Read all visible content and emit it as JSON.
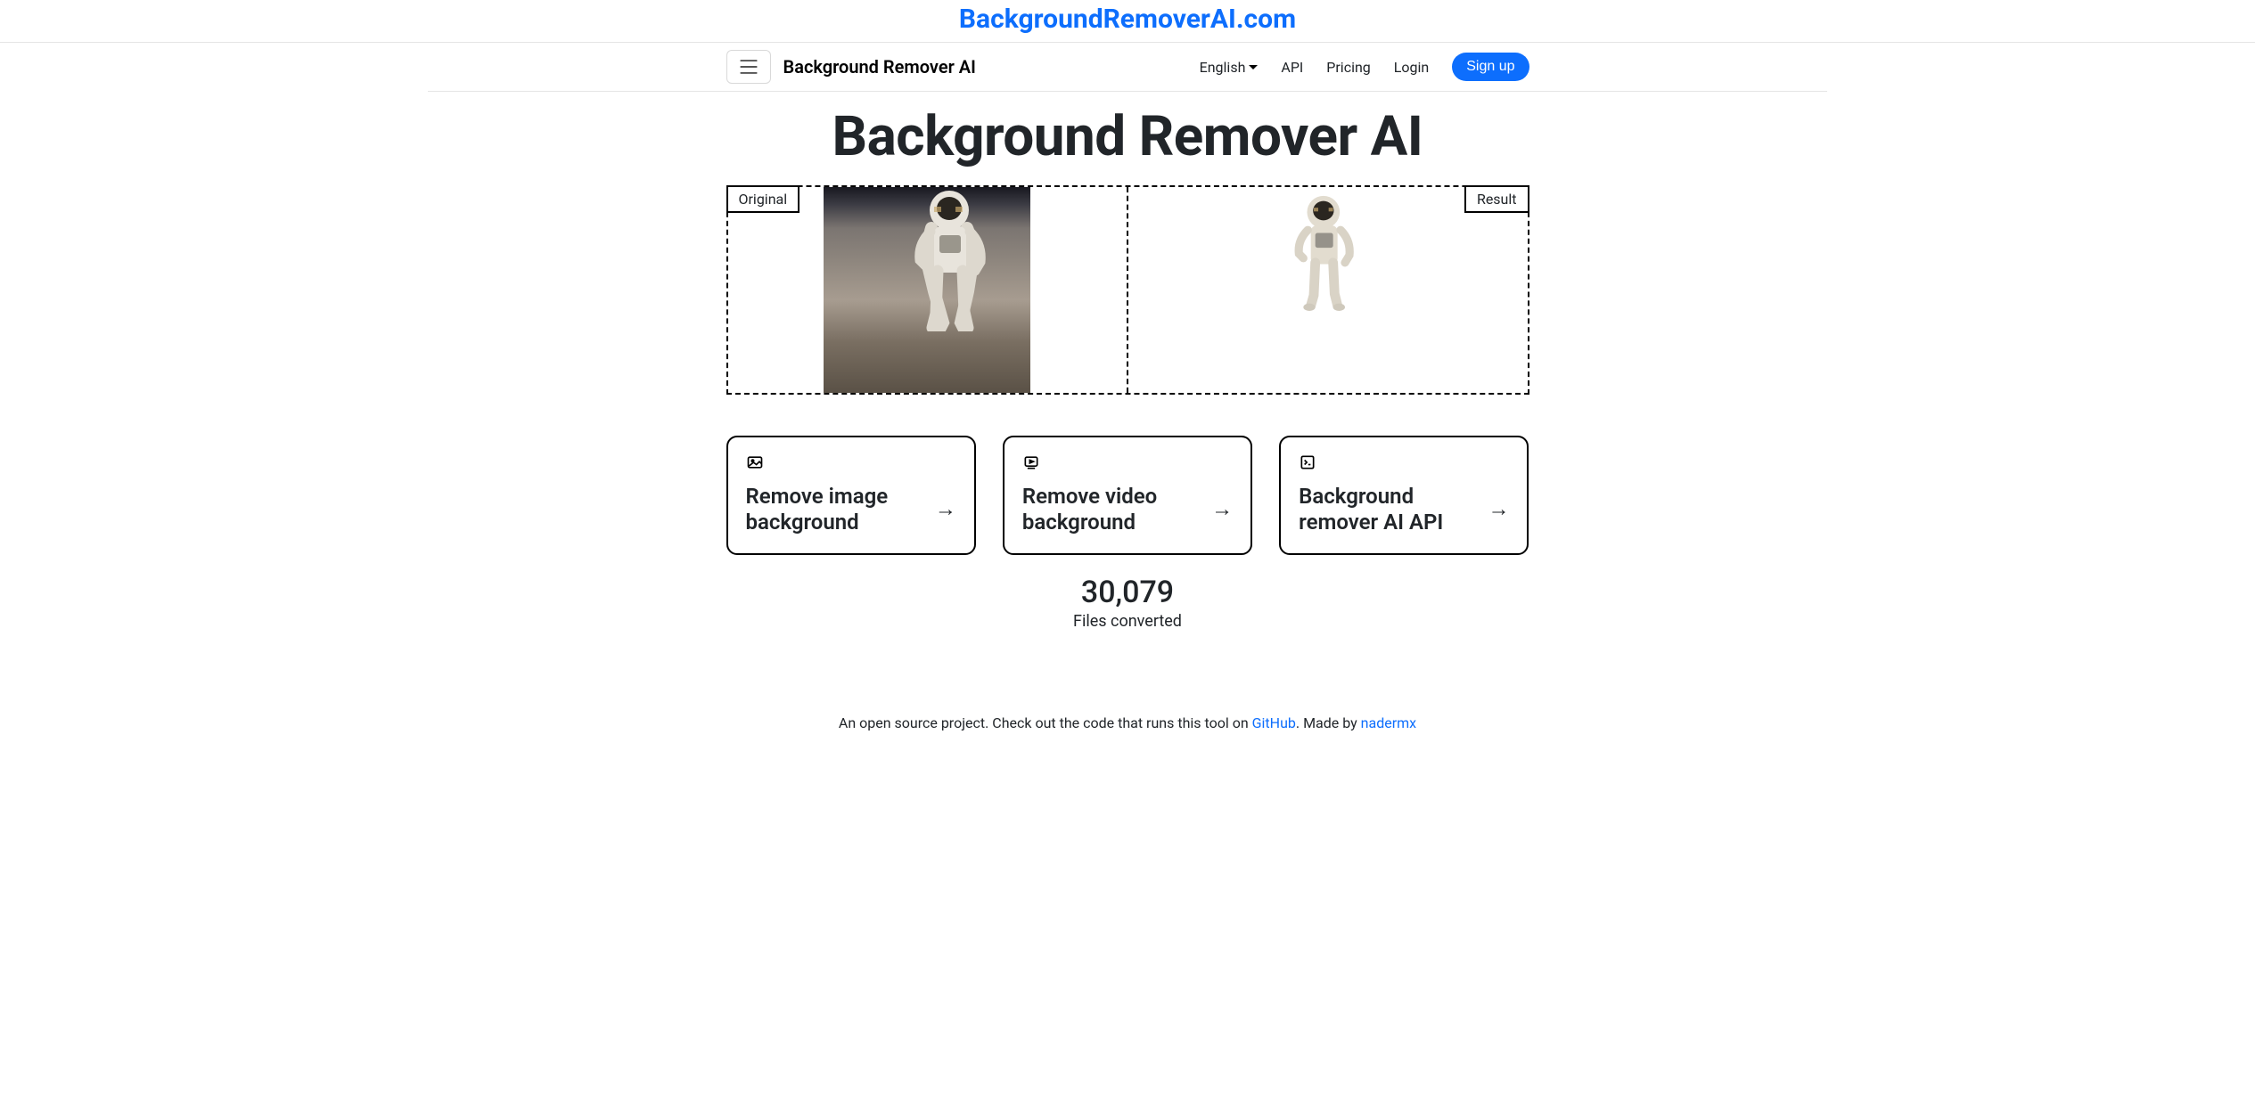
{
  "banner": {
    "text": "BackgroundRemoverAI.com"
  },
  "navbar": {
    "brand": "Background Remover AI",
    "language": "English",
    "api": "API",
    "pricing": "Pricing",
    "login": "Login",
    "signup": "Sign up"
  },
  "hero": {
    "title": "Background Remover AI"
  },
  "demo": {
    "original_label": "Original",
    "result_label": "Result"
  },
  "cards": [
    {
      "title": "Remove image background"
    },
    {
      "title": "Remove video background"
    },
    {
      "title": "Background remover AI API"
    }
  ],
  "stats": {
    "count": "30,079",
    "label": "Files converted"
  },
  "footer": {
    "prefix": "An open source project. Check out the code that runs this tool on ",
    "github": "GitHub",
    "made_by_prefix": ". Made by ",
    "author": "nadermx"
  }
}
